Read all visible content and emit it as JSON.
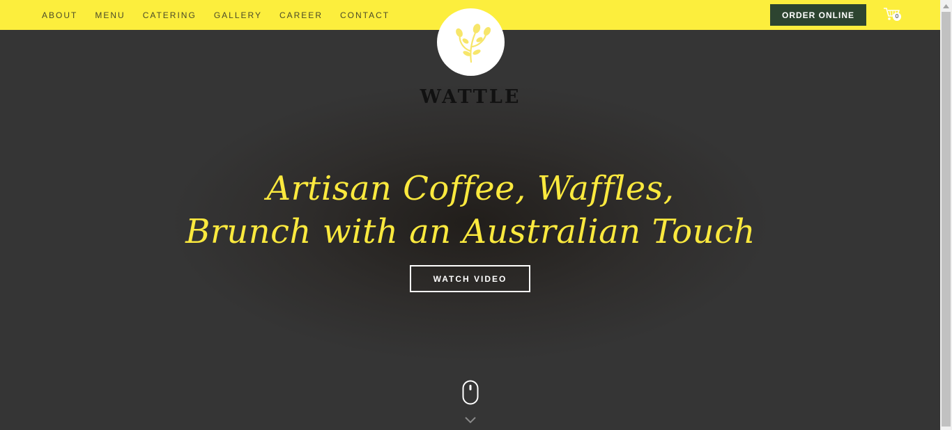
{
  "nav": {
    "links": [
      "ABOUT",
      "MENU",
      "CATERING",
      "GALLERY",
      "CAREER",
      "CONTACT"
    ],
    "order_button": "ORDER ONLINE",
    "cart_count": "0"
  },
  "brand": {
    "name": "WATTLE",
    "logo_icon": "wattle-flower-icon"
  },
  "hero": {
    "headline_line1": "Artisan Coffee, Waffles,",
    "headline_line2": "Brunch with an Australian Touch",
    "watch_button": "WATCH VIDEO",
    "scroll_icon": "mouse-icon",
    "scroll_arrow_icon": "chevron-down-icon"
  },
  "colors": {
    "nav_bg": "#fcee3d",
    "hero_bg": "#353535",
    "headline": "#fbe93e",
    "order_button_bg": "#2d4430"
  }
}
